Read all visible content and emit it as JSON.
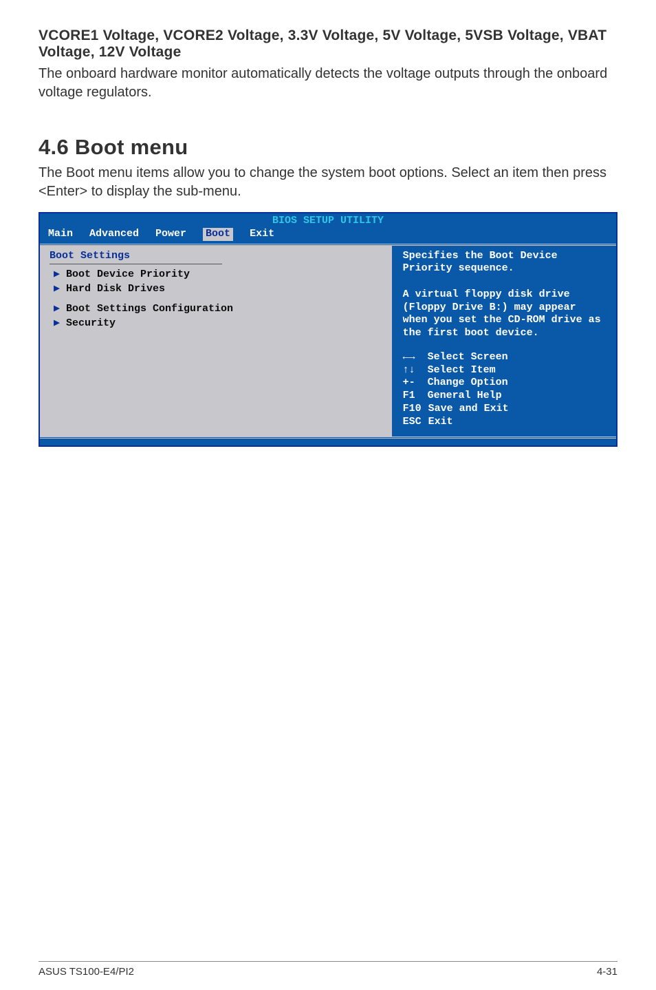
{
  "doc": {
    "heading": "VCORE1 Voltage, VCORE2 Voltage, 3.3V Voltage, 5V Voltage, 5VSB Voltage, VBAT Voltage, 12V Voltage",
    "para1": "The onboard hardware monitor automatically detects the voltage outputs through the onboard voltage regulators.",
    "section_title": "4.6 Boot menu",
    "para2": "The Boot menu items allow you to change the system boot options. Select an item then press <Enter> to display the sub-menu."
  },
  "bios": {
    "title": "BIOS SETUP UTILITY",
    "tabs": {
      "main": "Main",
      "advanced": "Advanced",
      "power": "Power",
      "boot": "Boot",
      "exit": "Exit",
      "selected": "boot"
    },
    "left": {
      "panel_title": "Boot Settings",
      "items": [
        {
          "label": "Boot Device Priority"
        },
        {
          "label": "Hard Disk Drives"
        }
      ],
      "items2": [
        {
          "label": "Boot Settings Configuration"
        },
        {
          "label": "Security"
        }
      ]
    },
    "right": {
      "help_text": "Specifies the Boot Device Priority sequence.\n\nA virtual floppy disk drive (Floppy Drive B:) may appear when you set the CD-ROM drive as the first boot device.",
      "keys": [
        {
          "sym": "←→",
          "label": "Select Screen"
        },
        {
          "sym": "↑↓",
          "label": "Select Item"
        },
        {
          "sym": "+-",
          "label": "Change Option"
        },
        {
          "sym": "F1",
          "label": "General Help"
        },
        {
          "sym": "F10",
          "label": "Save and Exit"
        },
        {
          "sym": "ESC",
          "label": "Exit"
        }
      ]
    }
  },
  "footer": {
    "left": "ASUS TS100-E4/PI2",
    "right": "4-31"
  }
}
